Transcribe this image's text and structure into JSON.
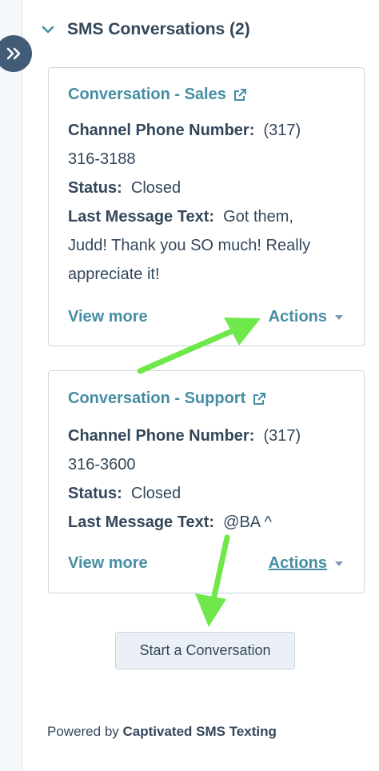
{
  "section": {
    "title": "SMS Conversations (2)",
    "expand_icon": "double-chevron-right-icon",
    "collapse_icon": "chevron-down-icon"
  },
  "conversations": [
    {
      "title": "Conversation - Sales",
      "phone_label": "Channel Phone Number:",
      "phone_value_part1": "(317)",
      "phone_value_part2": "316-3188",
      "status_label": "Status:",
      "status_value": "Closed",
      "last_msg_label": "Last Message Text:",
      "last_msg_part1": "Got them,",
      "last_msg_part2": "Judd! Thank you SO much! Really",
      "last_msg_part3": "appreciate it!",
      "view_more": "View more",
      "actions": "Actions"
    },
    {
      "title": "Conversation - Support",
      "phone_label": "Channel Phone Number:",
      "phone_value_part1": "(317)",
      "phone_value_part2": "316-3600",
      "status_label": "Status:",
      "status_value": "Closed",
      "last_msg_label": "Last Message Text:",
      "last_msg_part1": "@BA ^",
      "view_more": "View more",
      "actions": "Actions"
    }
  ],
  "start_button": "Start a Conversation",
  "footer": {
    "prefix": "Powered by",
    "brand": "Captivated SMS Texting"
  },
  "colors": {
    "link": "#468ea3",
    "text": "#33475b",
    "annotation_arrow": "#6ee84a"
  }
}
